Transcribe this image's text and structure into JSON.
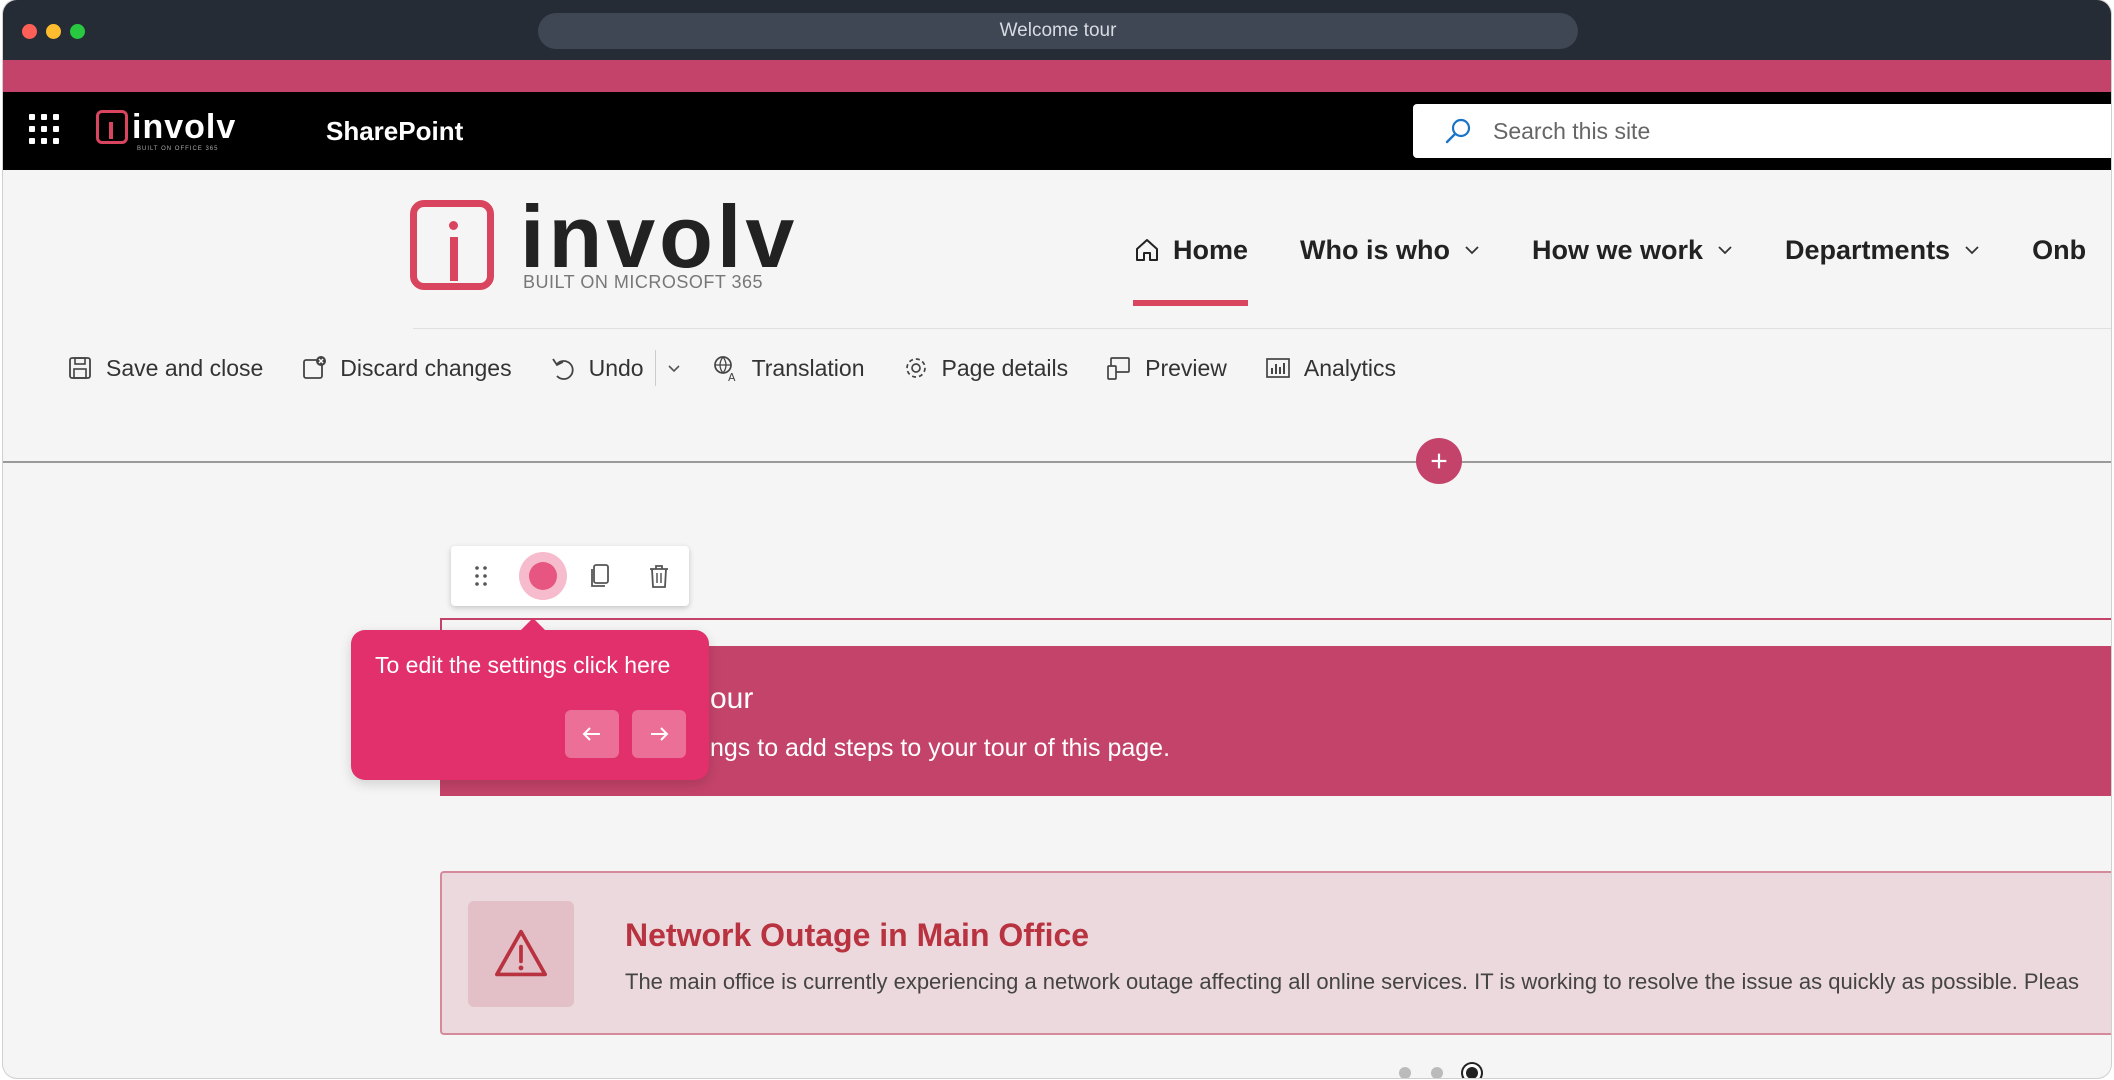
{
  "window": {
    "title": "Welcome tour"
  },
  "suitebar": {
    "logo_text": "involv",
    "logo_subtext": "BUILT ON OFFICE 365",
    "app_name": "SharePoint",
    "search_placeholder": "Search this site"
  },
  "site": {
    "logo_text": "involv",
    "logo_subtext": "BUILT ON MICROSOFT 365",
    "nav": [
      {
        "label": "Home",
        "icon": "home-icon",
        "active": true
      },
      {
        "label": "Who is who",
        "has_dropdown": true
      },
      {
        "label": "How we work",
        "has_dropdown": true
      },
      {
        "label": "Departments",
        "has_dropdown": true
      },
      {
        "label": "Onb",
        "has_dropdown": false
      }
    ]
  },
  "commandbar": {
    "save_close": "Save and close",
    "discard": "Discard changes",
    "undo": "Undo",
    "translation": "Translation",
    "page_details": "Page details",
    "preview": "Preview",
    "analytics": "Analytics"
  },
  "tour_webpart": {
    "title": "our",
    "description": "ngs to add steps to your tour of this page."
  },
  "tooltip": {
    "text": "To edit the settings click here"
  },
  "alert": {
    "title": "Network Outage in Main Office",
    "text": "The main office is currently experiencing a network outage affecting all online services. IT is working to resolve the issue as quickly as possible. Pleas"
  },
  "carousel": {
    "count": 3,
    "active_index": 2
  },
  "colors": {
    "brand": "#c4436a",
    "tooltip": "#e1306c",
    "alert_title": "#b8323f"
  }
}
